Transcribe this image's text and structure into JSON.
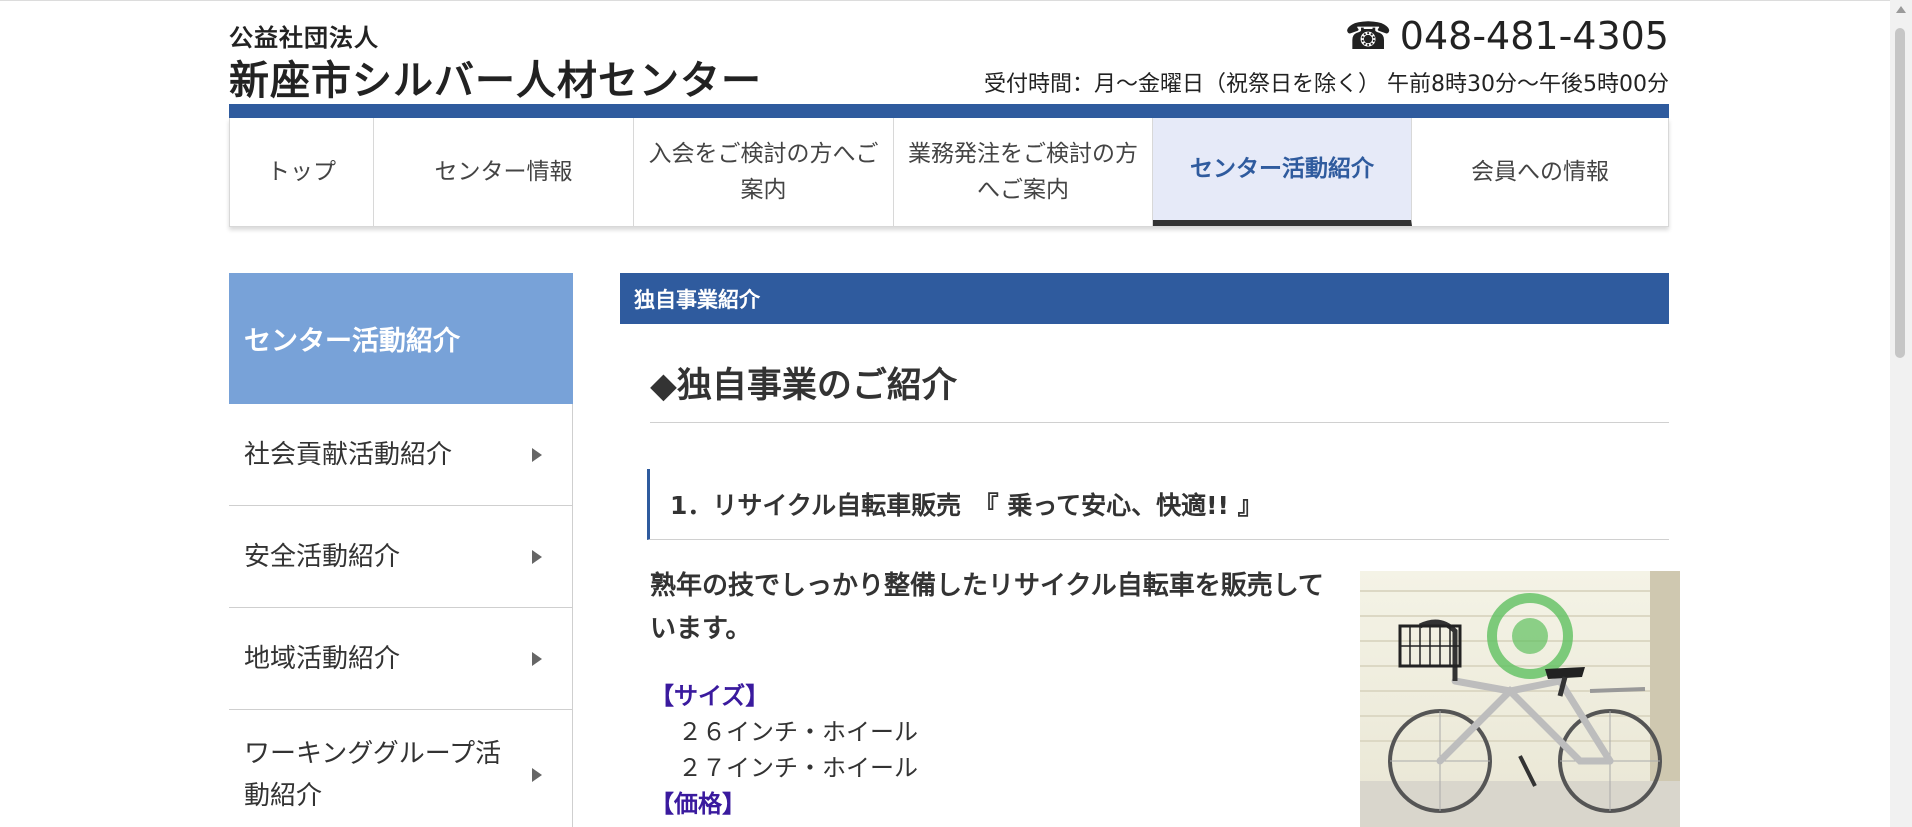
{
  "header": {
    "org_sub": "公益社団法人",
    "org_name": "新座市シルバー人材センター",
    "phone_icon": "phone-icon",
    "phone": "048-481-4305",
    "hours": "受付時間：月～金曜日（祝祭日を除く） 午前8時30分～午後5時00分"
  },
  "nav": {
    "items": [
      {
        "label": "トップ"
      },
      {
        "label": "センター情報"
      },
      {
        "label": "入会をご検討の方へご案内"
      },
      {
        "label": "業務発注をご検討の方へご案内"
      },
      {
        "label": "センター活動紹介"
      },
      {
        "label": "会員への情報"
      }
    ],
    "active_index": 4
  },
  "sidebar": {
    "heading": "センター活動紹介",
    "items": [
      {
        "label": "社会貢献活動紹介"
      },
      {
        "label": "安全活動紹介"
      },
      {
        "label": "地域活動紹介"
      },
      {
        "label": "ワーキンググループ活動紹介"
      }
    ]
  },
  "main": {
    "section_title": "独自事業紹介",
    "heading": "◆独自事業のご紹介",
    "subheading": "1．リサイクル自転車販売　『 乗って安心、快適!! 』",
    "lead": "熟年の技でしっかり整備したリサイクル自転車を販売しています。",
    "size_label": "【サイズ】",
    "size_values": [
      "２６インチ・ホイール",
      "２７インチ・ホイール"
    ],
    "price_label": "【価格】"
  },
  "colors": {
    "brand_blue": "#2f5b9e",
    "sidebar_head": "#78a2d8",
    "nav_active_bg": "#e6eaf8",
    "spec_label": "#3a1a9e"
  }
}
